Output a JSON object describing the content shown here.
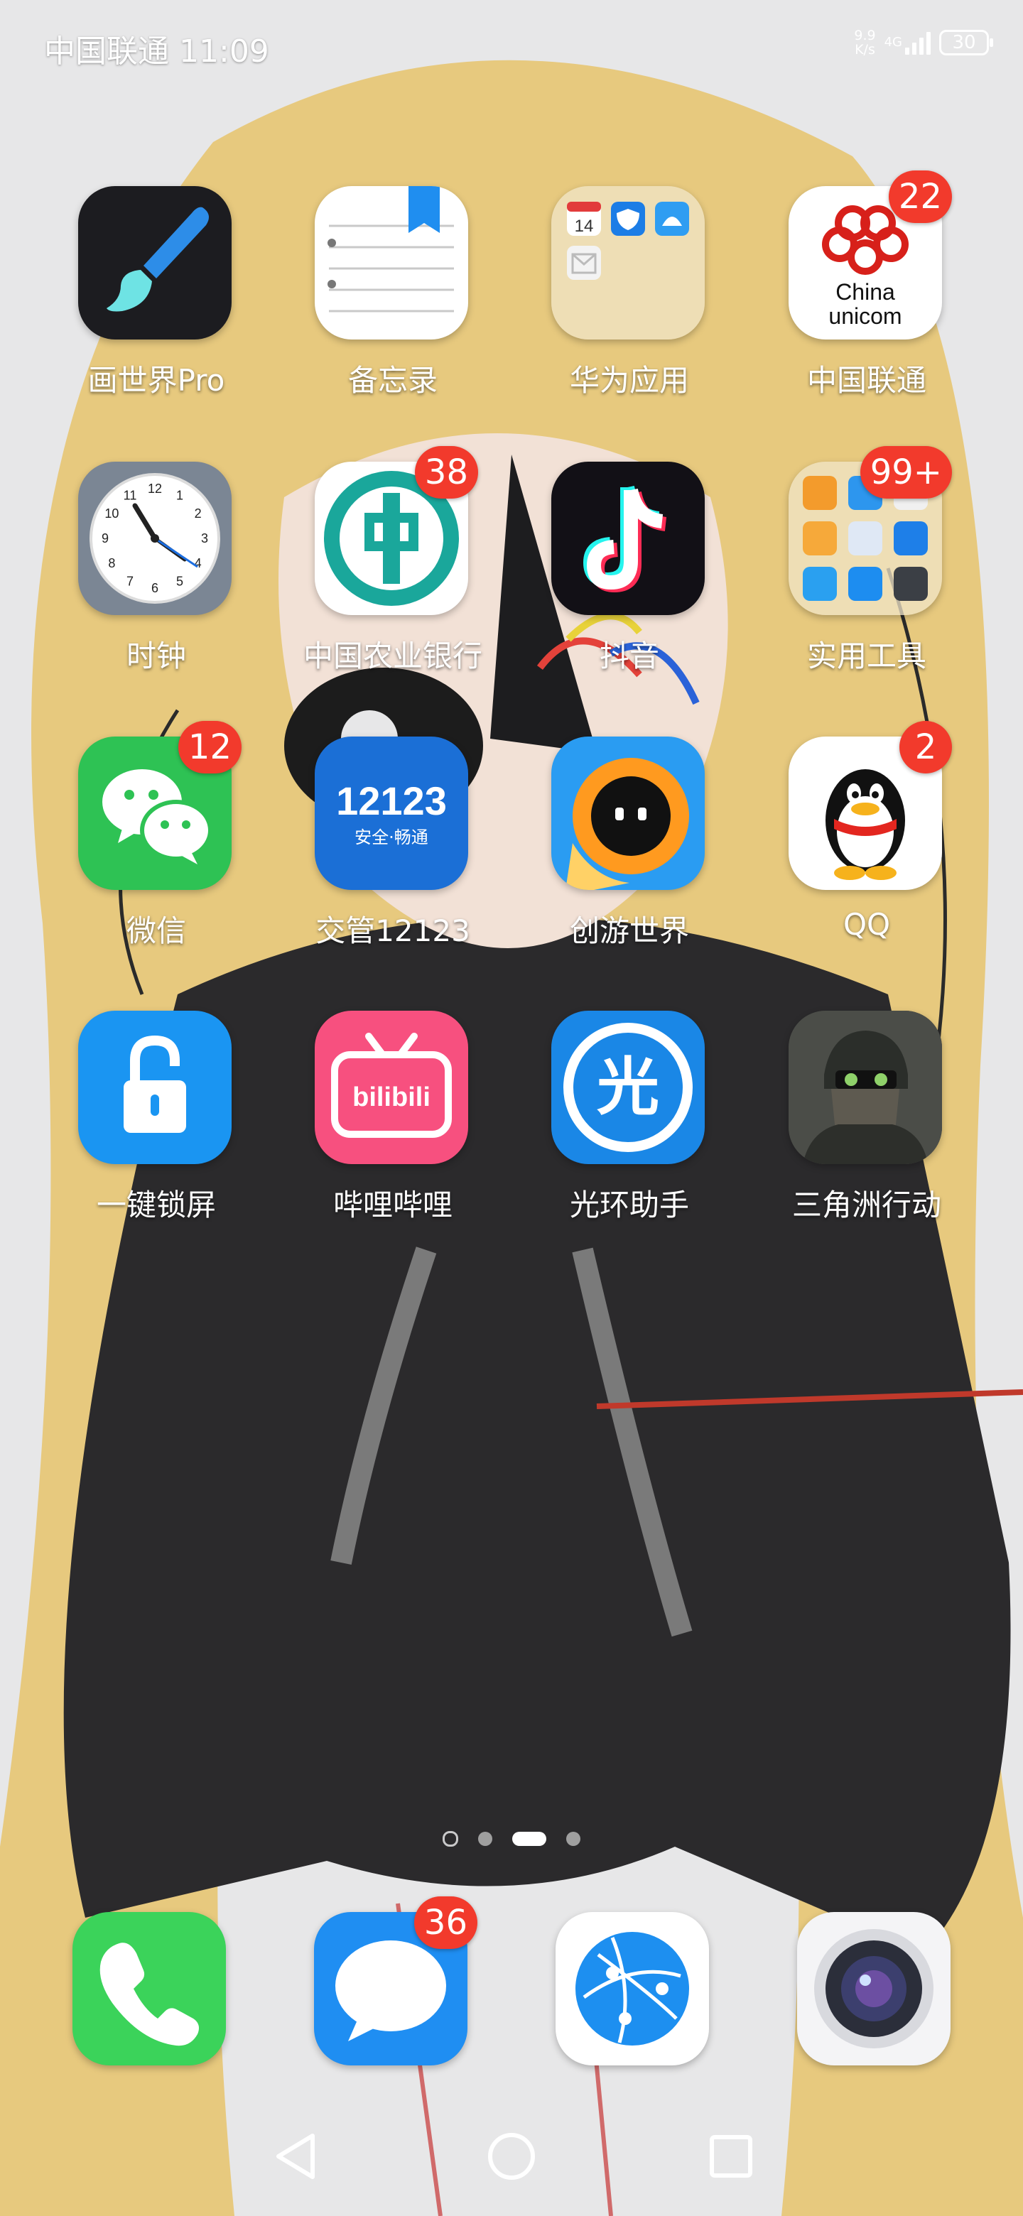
{
  "status_bar": {
    "carrier": "中国联通",
    "time": "11:09",
    "net_speed_value": "9.9",
    "net_speed_unit": "K/s",
    "network_type": "4G",
    "battery_level": "30"
  },
  "apps": [
    {
      "label": "画世界Pro",
      "icon": "paint-brush-icon"
    },
    {
      "label": "备忘录",
      "icon": "notepad-icon"
    },
    {
      "label": "华为应用",
      "icon": "folder-icon"
    },
    {
      "label": "中国联通",
      "icon": "china-unicom-icon",
      "badge": "22"
    },
    {
      "label": "时钟",
      "icon": "clock-icon"
    },
    {
      "label": "中国农业银行",
      "icon": "abc-bank-icon",
      "badge": "38"
    },
    {
      "label": "抖音",
      "icon": "tiktok-icon"
    },
    {
      "label": "实用工具",
      "icon": "folder-icon",
      "badge": "99+"
    },
    {
      "label": "微信",
      "icon": "wechat-icon",
      "badge": "12"
    },
    {
      "label": "交管12123",
      "icon": "traffic-12123-icon",
      "icon_text": "12123",
      "icon_subtext": "安全·畅通"
    },
    {
      "label": "创游世界",
      "icon": "game-world-icon"
    },
    {
      "label": "QQ",
      "icon": "qq-penguin-icon",
      "badge": "2"
    },
    {
      "label": "一键锁屏",
      "icon": "unlock-icon"
    },
    {
      "label": "哔哩哔哩",
      "icon": "bilibili-icon",
      "icon_text": "bilibili"
    },
    {
      "label": "光环助手",
      "icon": "halo-assistant-icon",
      "icon_text": "光"
    },
    {
      "label": "三角洲行动",
      "icon": "soldier-icon"
    }
  ],
  "folder_huawei": {
    "calendar_day": "14"
  },
  "clock": {
    "numbers": [
      "12",
      "1",
      "2",
      "3",
      "4",
      "5",
      "6",
      "7",
      "8",
      "9",
      "10",
      "11"
    ]
  },
  "unicom_logo": {
    "line1": "China",
    "line2": "unicom"
  },
  "page_indicator": {
    "pages": 4,
    "current": 3
  },
  "dock": [
    {
      "icon": "phone-icon"
    },
    {
      "icon": "messages-icon",
      "badge": "36"
    },
    {
      "icon": "browser-icon"
    },
    {
      "icon": "camera-icon"
    }
  ],
  "colors": {
    "badge": "#f23a2c",
    "wechat": "#2ec254",
    "bilibili": "#f7507f",
    "huawei_blue": "#1a87e6"
  }
}
